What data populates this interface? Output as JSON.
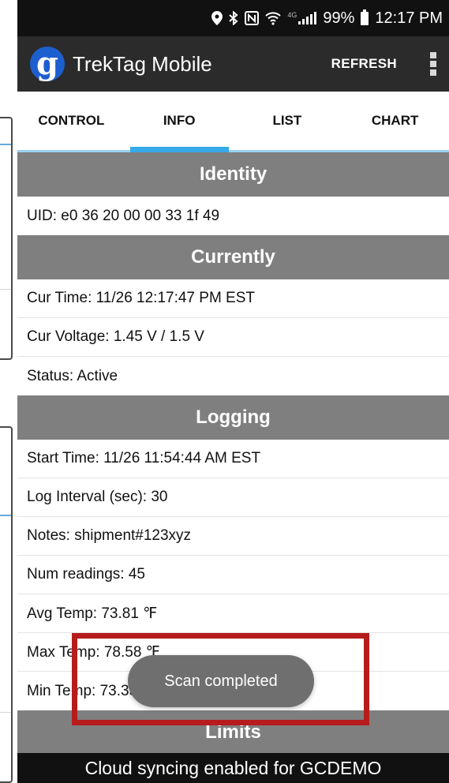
{
  "status_bar": {
    "battery_percent": "99%",
    "time": "12:17 PM",
    "network_tag": "4G",
    "icons": [
      "location-icon",
      "bluetooth-icon",
      "nfc-icon",
      "wifi-icon",
      "signal-icon",
      "battery-icon"
    ]
  },
  "app_bar": {
    "logo_letter": "g",
    "title": "TrekTag Mobile",
    "refresh_label": "REFRESH"
  },
  "tabs": [
    {
      "label": "CONTROL",
      "active": false
    },
    {
      "label": "INFO",
      "active": true
    },
    {
      "label": "LIST",
      "active": false
    },
    {
      "label": "CHART",
      "active": false
    }
  ],
  "sections": {
    "identity": {
      "title": "Identity",
      "rows": [
        "UID: e0 36 20 00 00 33 1f 49"
      ]
    },
    "currently": {
      "title": "Currently",
      "rows": [
        "Cur Time: 11/26 12:17:47 PM EST",
        "Cur Voltage: 1.45 V / 1.5 V",
        "Status: Active"
      ]
    },
    "logging": {
      "title": "Logging",
      "rows": [
        "Start Time: 11/26 11:54:44 AM EST",
        "Log Interval (sec): 30",
        "Notes: shipment#123xyz",
        "Num readings: 45",
        "Avg Temp: 73.81 ℉",
        "Max Temp: 78.58 ℉",
        "Min Temp: 73.35 ℉"
      ]
    },
    "limits": {
      "title": "Limits"
    }
  },
  "toast": {
    "message": "Scan completed"
  },
  "cloud_bar": {
    "message": "Cloud syncing enabled for GCDEMO"
  },
  "colors": {
    "app_bar": "#2b2b2b",
    "status_bar": "#111111",
    "tab_indicator": "#36a9e8",
    "section_header": "#7f7f7f",
    "logo": "#1e5fd0",
    "highlight": "#b71c1c"
  }
}
